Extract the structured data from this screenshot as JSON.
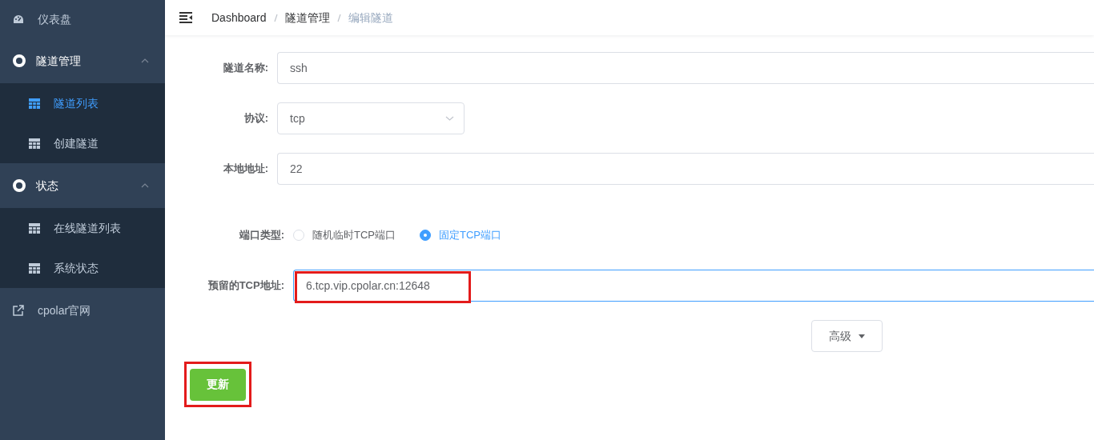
{
  "sidebar": {
    "items": [
      {
        "kind": "link",
        "label": "仪表盘",
        "selected": false
      },
      {
        "kind": "group",
        "label": "隧道管理",
        "expanded": true,
        "children": [
          {
            "label": "隧道列表",
            "selected": true
          },
          {
            "label": "创建隧道",
            "selected": false
          }
        ]
      },
      {
        "kind": "group",
        "label": "状态",
        "expanded": true,
        "children": [
          {
            "label": "在线隧道列表",
            "selected": false
          },
          {
            "label": "系统状态",
            "selected": false
          }
        ]
      },
      {
        "kind": "link",
        "label": "cpolar官网",
        "selected": false
      }
    ]
  },
  "breadcrumb": [
    "Dashboard",
    "隧道管理",
    "编辑隧道"
  ],
  "form": {
    "fields": [
      {
        "kind": "text",
        "label": "隧道名称:",
        "value": "ssh"
      },
      {
        "kind": "select",
        "label": "协议:",
        "value": "tcp"
      },
      {
        "kind": "text",
        "label": "本地地址:",
        "value": "22"
      },
      {
        "kind": "radio",
        "label": "端口类型:",
        "options": [
          {
            "label": "随机临时TCP端口",
            "selected": false
          },
          {
            "label": "固定TCP端口",
            "selected": true
          }
        ]
      },
      {
        "kind": "text",
        "label": "预留的TCP地址:",
        "value": "6.tcp.vip.cpolar.cn:12648",
        "focused": true,
        "highlighted": true
      }
    ],
    "advanced_button": "高级",
    "submit": {
      "label": "更新",
      "highlighted": true
    }
  }
}
